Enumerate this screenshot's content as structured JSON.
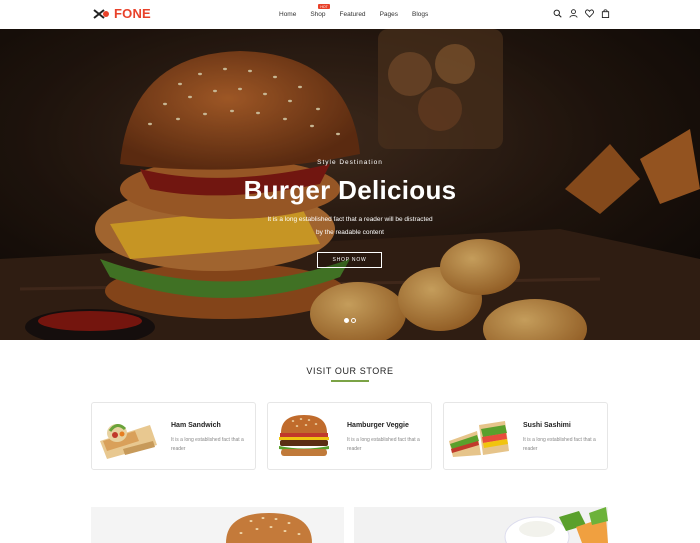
{
  "header": {
    "logo_text": "FONE",
    "nav": [
      {
        "label": "Home"
      },
      {
        "label": "Shop",
        "badge": "HOT"
      },
      {
        "label": "Featured"
      },
      {
        "label": "Pages"
      },
      {
        "label": "Blogs"
      }
    ],
    "icons": [
      "search-icon",
      "user-icon",
      "heart-icon",
      "bag-icon"
    ]
  },
  "hero": {
    "subtitle": "Style Destination",
    "title": "Burger Delicious",
    "description": "It is a long established fact that a reader will be distracted by the readable content",
    "button_label": "SHOP NOW",
    "slides": 2,
    "active_slide": 1
  },
  "store": {
    "title": "VISIT OUR STORE",
    "cards": [
      {
        "title": "Ham Sandwich",
        "description": "It is a long established fact that a reader",
        "image": "wrap-image"
      },
      {
        "title": "Hamburger Veggie",
        "description": "It is a long established fact that a reader",
        "image": "burger-image"
      },
      {
        "title": "Sushi Sashimi",
        "description": "It is a long established fact that a reader",
        "image": "sandwich-image"
      }
    ]
  },
  "colors": {
    "accent": "#e8412a",
    "underline": "#7ba346"
  }
}
